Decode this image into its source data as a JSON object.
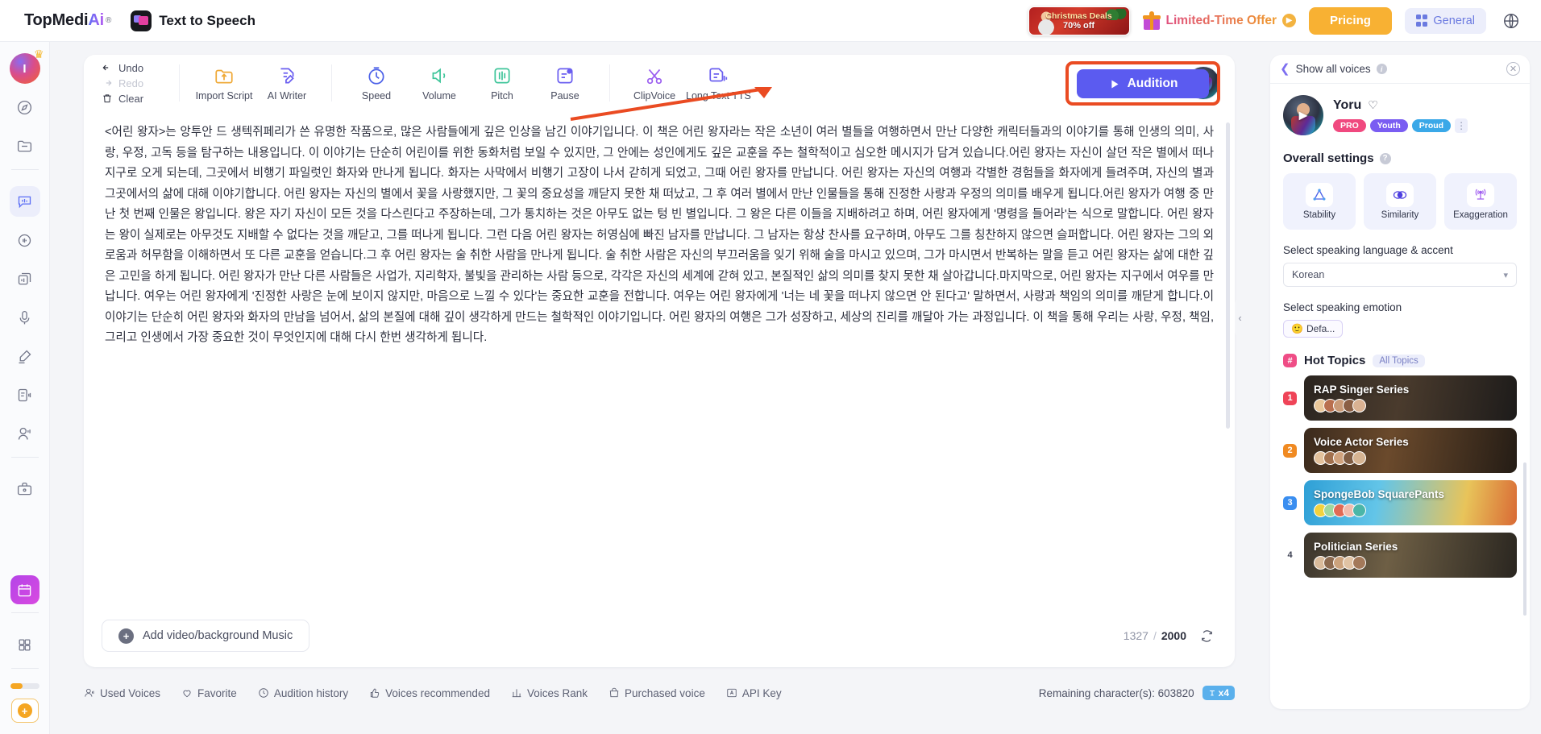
{
  "header": {
    "brand_top": "TopMedi",
    "brand_ai": "Ai",
    "brand_reg": "®",
    "app_title": "Text to Speech",
    "promo_banner_line1": "Christmas Deals",
    "promo_banner_line2": "70% off",
    "limited_offer": "Limited-Time Offer",
    "pricing": "Pricing",
    "general": "General",
    "globe_icon": "globe-icon"
  },
  "rail": {
    "avatar_initial": "I",
    "items": [
      {
        "name": "explore-icon"
      },
      {
        "name": "folder-icon"
      },
      {
        "name": "text-to-speech-icon"
      },
      {
        "name": "voice-changer-icon"
      },
      {
        "name": "batch-tts-icon"
      },
      {
        "name": "voice-clone-icon"
      },
      {
        "name": "speech-to-text-icon"
      },
      {
        "name": "subtitle-icon"
      },
      {
        "name": "ai-avatar-icon"
      },
      {
        "name": "toolbox-icon"
      }
    ],
    "calendar_icon": "calendar-icon",
    "apps_icon": "apps-grid-icon",
    "add_icon": "add-plus-icon"
  },
  "toolbar": {
    "undo": "Undo",
    "redo": "Redo",
    "clear": "Clear",
    "items": [
      {
        "label": "Import Script",
        "icon": "import-script-icon"
      },
      {
        "label": "AI Writer",
        "icon": "ai-writer-icon"
      },
      {
        "label": "Speed",
        "icon": "speed-icon"
      },
      {
        "label": "Volume",
        "icon": "volume-icon"
      },
      {
        "label": "Pitch",
        "icon": "pitch-icon"
      },
      {
        "label": "Pause",
        "icon": "pause-icon"
      },
      {
        "label": "ClipVoice",
        "icon": "scissors-icon"
      },
      {
        "label": "Long Text TTS",
        "icon": "long-text-tts-icon"
      }
    ],
    "audition": "Audition"
  },
  "editor": {
    "script": "<어린 왕자>는 앙투안 드 생텍쥐페리가 쓴 유명한 작품으로, 많은 사람들에게 깊은 인상을 남긴 이야기입니다. 이 책은 어린 왕자라는 작은 소년이 여러 별들을 여행하면서 만난 다양한 캐릭터들과의 이야기를 통해 인생의 의미, 사랑, 우정, 고독 등을 탐구하는 내용입니다. 이 이야기는 단순히 어린이를 위한 동화처럼 보일 수 있지만, 그 안에는 성인에게도 깊은 교훈을 주는 철학적이고 심오한 메시지가 담겨 있습니다.어린 왕자는 자신이 살던 작은 별에서 떠나 지구로 오게 되는데, 그곳에서 비행기 파일럿인 화자와 만나게 됩니다. 화자는 사막에서 비행기 고장이 나서 갇히게 되었고, 그때 어린 왕자를 만납니다. 어린 왕자는 자신의 여행과 각별한 경험들을 화자에게 들려주며, 자신의 별과 그곳에서의 삶에 대해 이야기합니다. 어린 왕자는 자신의 별에서 꽃을 사랑했지만, 그 꽃의 중요성을 깨닫지 못한 채 떠났고, 그 후 여러 별에서 만난 인물들을 통해 진정한 사랑과 우정의 의미를 배우게 됩니다.어린 왕자가 여행 중 만난 첫 번째 인물은 왕입니다. 왕은 자기 자신이 모든 것을 다스린다고 주장하는데, 그가 통치하는 것은 아무도 없는 텅 빈 별입니다. 그 왕은 다른 이들을 지배하려고 하며, 어린 왕자에게 '명령을 들어라'는 식으로 말합니다. 어린 왕자는 왕이 실제로는 아무것도 지배할 수 없다는 것을 깨닫고, 그를 떠나게 됩니다. 그런 다음 어린 왕자는 허영심에 빠진 남자를 만납니다. 그 남자는 항상 찬사를 요구하며, 아무도 그를 칭찬하지 않으면 슬퍼합니다. 어린 왕자는 그의 외로움과 허무함을 이해하면서 또 다른 교훈을 얻습니다.그 후 어린 왕자는 술 취한 사람을 만나게 됩니다. 술 취한 사람은 자신의 부끄러움을 잊기 위해 술을 마시고 있으며, 그가 마시면서 반복하는 말을 듣고 어린 왕자는 삶에 대한 깊은 고민을 하게 됩니다. 어린 왕자가 만난 다른 사람들은 사업가, 지리학자, 불빛을 관리하는 사람 등으로, 각각은 자신의 세계에 갇혀 있고, 본질적인 삶의 의미를 찾지 못한 채 살아갑니다.마지막으로, 어린 왕자는 지구에서 여우를 만납니다. 여우는 어린 왕자에게 '진정한 사랑은 눈에 보이지 않지만, 마음으로 느낄 수 있다'는 중요한 교훈을 전합니다. 여우는 어린 왕자에게 '너는 네 꽃을 떠나지 않으면 안 된다고' 말하면서, 사랑과 책임의 의미를 깨닫게 합니다.이 이야기는 단순히 어린 왕자와 화자의 만남을 넘어서, 삶의 본질에 대해 깊이 생각하게 만드는 철학적인 이야기입니다. 어린 왕자의 여행은 그가 성장하고, 세상의 진리를 깨달아 가는 과정입니다. 이 책을 통해 우리는 사랑, 우정, 책임, 그리고 인생에서 가장 중요한 것이 무엇인지에 대해 다시 한번 생각하게 됩니다.",
    "add_media": "Add video/background Music",
    "char_current": "1327",
    "char_sep": "/",
    "char_max": "2000",
    "refresh_icon": "refresh-icon"
  },
  "bottom_bar": {
    "items": [
      {
        "label": "Used Voices",
        "icon": "used-voices-icon"
      },
      {
        "label": "Favorite",
        "icon": "heart-icon"
      },
      {
        "label": "Audition history",
        "icon": "history-clock-icon"
      },
      {
        "label": "Voices recommended",
        "icon": "thumbs-up-icon"
      },
      {
        "label": "Voices Rank",
        "icon": "bar-chart-icon"
      },
      {
        "label": "Purchased voice",
        "icon": "shopping-bag-icon"
      },
      {
        "label": "API Key",
        "icon": "api-key-icon"
      }
    ],
    "remaining_label": "Remaining character(s): 603820",
    "multiplier_badge": "x4"
  },
  "right_panel": {
    "show_all_voices": "Show all voices",
    "back_icon": "chevron-left-icon",
    "info_icon": "info-icon",
    "close_icon": "close-icon",
    "voice_name": "Yoru",
    "favorite_icon": "heart-outline-icon",
    "tags": [
      "PRO",
      "Youth",
      "Proud"
    ],
    "kebab_icon": "more-vertical-icon",
    "overall_settings_title": "Overall settings",
    "settings": [
      {
        "label": "Stability",
        "icon": "stability-triangle-icon"
      },
      {
        "label": "Similarity",
        "icon": "similarity-circles-icon"
      },
      {
        "label": "Exaggeration",
        "icon": "exaggeration-antenna-icon"
      }
    ],
    "language_label": "Select speaking language & accent",
    "language_value": "Korean",
    "emotion_label": "Select speaking emotion",
    "emotion_value": "Defa...",
    "emotion_emoji": "🙂",
    "hot_topics_title": "Hot Topics",
    "all_topics": "All Topics",
    "topics": [
      {
        "rank": "1",
        "title": "RAP Singer Series",
        "avatars": 5
      },
      {
        "rank": "2",
        "title": "Voice Actor Series",
        "avatars": 5
      },
      {
        "rank": "3",
        "title": "SpongeBob SquarePants",
        "avatars": 5
      },
      {
        "rank": "4",
        "title": "Politician Series",
        "avatars": 5
      }
    ]
  },
  "colors": {
    "accent_purple": "#5b5bf0",
    "highlight_orange": "#ea4b22",
    "pricing_yellow": "#f8b133"
  }
}
